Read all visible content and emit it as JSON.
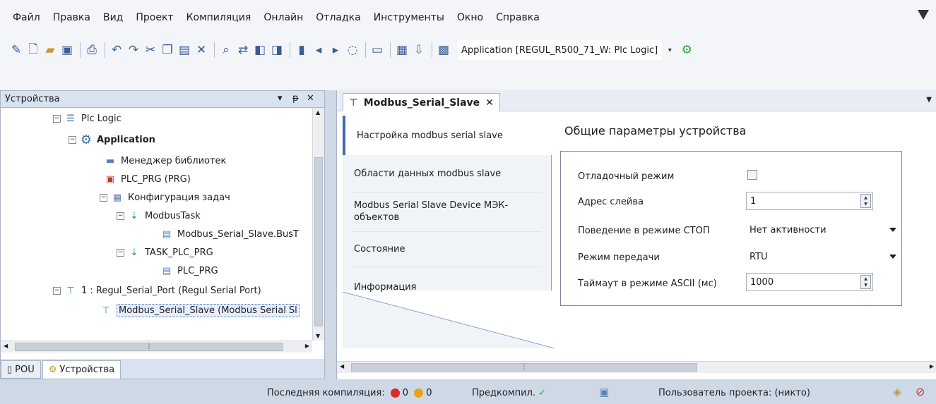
{
  "menu": [
    "Файл",
    "Правка",
    "Вид",
    "Проект",
    "Компиляция",
    "Онлайн",
    "Отладка",
    "Инструменты",
    "Окно",
    "Справка"
  ],
  "toolbar": {
    "application_combo": "Application [REGUL_R500_71_W: Plc Logic]"
  },
  "devices_pane": {
    "title": "Устройства",
    "tree": [
      {
        "label": "Plc Logic",
        "icon": "plc-logic-icon"
      },
      {
        "label": "Application",
        "icon": "application-gear-icon"
      },
      {
        "label": "Менеджер библиотек",
        "icon": "library-manager-icon"
      },
      {
        "label": "PLC_PRG (PRG)",
        "icon": "pou-program-icon"
      },
      {
        "label": "Конфигурация задач",
        "icon": "task-config-icon"
      },
      {
        "label": "ModbusTask",
        "icon": "task-icon"
      },
      {
        "label": "Modbus_Serial_Slave.BusT",
        "icon": "bus-task-icon"
      },
      {
        "label": "TASK_PLC_PRG",
        "icon": "task-icon"
      },
      {
        "label": "PLC_PRG",
        "icon": "program-call-icon"
      },
      {
        "label": "1 : Regul_Serial_Port (Regul Serial Port)",
        "icon": "device-icon"
      },
      {
        "label": "Modbus_Serial_Slave (Modbus Serial Sl",
        "icon": "device-icon"
      }
    ],
    "tabs": [
      "POU",
      "Устройства"
    ]
  },
  "editor": {
    "tab_label": "Modbus_Serial_Slave",
    "side_tabs": [
      "Настройка modbus serial slave",
      "Области данных modbus slave",
      "Modbus Serial Slave Device МЭК-объектов",
      "Состояние",
      "Информация"
    ],
    "group_title": "Общие параметры устройства",
    "params": {
      "debug_label": "Отладочный режим",
      "debug_checked": false,
      "address_label": "Адрес слейва",
      "address_value": "1",
      "stop_label": "Поведение в режиме СТОП",
      "stop_value": "Нет активности",
      "mode_label": "Режим передачи",
      "mode_value": "RTU",
      "timeout_label": "Таймаут в режиме ASCII (мс)",
      "timeout_value": "1000"
    }
  },
  "status": {
    "last_compile": "Последняя компиляция:",
    "errors": "0",
    "warnings": "0",
    "precompile": "Предкомпил.",
    "project_user": "Пользователь проекта: (никто)"
  },
  "colors": {
    "selection": "#3f6bb4",
    "error": "#d92b2b",
    "warning": "#e8a317",
    "ok": "#2ea043"
  }
}
